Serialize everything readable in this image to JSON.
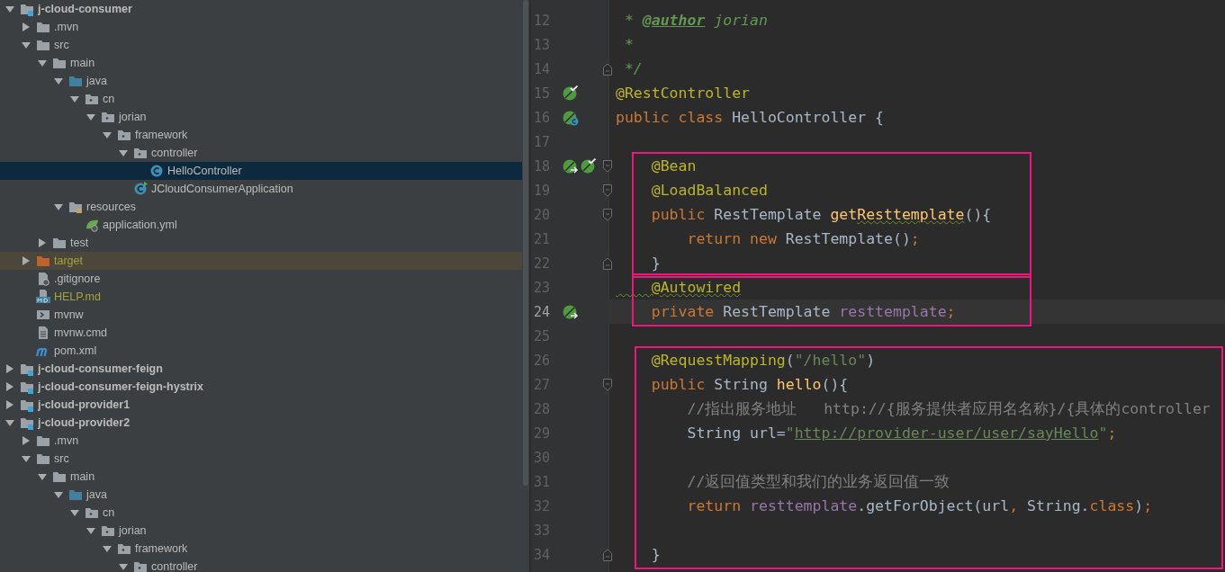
{
  "project_tree": {
    "items": [
      {
        "label": "j-cloud-consumer",
        "kind": "module",
        "expanded": true,
        "selected": false,
        "ignored": false,
        "children": [
          {
            "label": ".mvn",
            "kind": "folder",
            "expanded": false,
            "selected": false,
            "ignored": false
          },
          {
            "label": "src",
            "kind": "folder",
            "expanded": true,
            "selected": false,
            "ignored": false,
            "children": [
              {
                "label": "main",
                "kind": "folder",
                "expanded": true,
                "selected": false,
                "ignored": false,
                "children": [
                  {
                    "label": "java",
                    "kind": "source",
                    "expanded": true,
                    "selected": false,
                    "ignored": false,
                    "children": [
                      {
                        "label": "cn",
                        "kind": "package",
                        "expanded": true,
                        "selected": false,
                        "ignored": false,
                        "children": [
                          {
                            "label": "jorian",
                            "kind": "package",
                            "expanded": true,
                            "selected": false,
                            "ignored": false,
                            "children": [
                              {
                                "label": "framework",
                                "kind": "package",
                                "expanded": true,
                                "selected": false,
                                "ignored": false,
                                "children": [
                                  {
                                    "label": "controller",
                                    "kind": "package",
                                    "expanded": true,
                                    "selected": false,
                                    "ignored": false,
                                    "children": [
                                      {
                                        "label": "HelloController",
                                        "kind": "class",
                                        "selected": true,
                                        "ignored": false
                                      }
                                    ]
                                  },
                                  {
                                    "label": "JCloudConsumerApplication",
                                    "kind": "app",
                                    "selected": false,
                                    "ignored": false
                                  }
                                ]
                              }
                            ]
                          }
                        ]
                      }
                    ]
                  },
                  {
                    "label": "resources",
                    "kind": "resources",
                    "expanded": true,
                    "selected": false,
                    "ignored": false,
                    "children": [
                      {
                        "label": "application.yml",
                        "kind": "yml",
                        "selected": false,
                        "ignored": false
                      }
                    ]
                  }
                ]
              },
              {
                "label": "test",
                "kind": "folder",
                "expanded": false,
                "selected": false,
                "ignored": false
              }
            ]
          },
          {
            "label": "target",
            "kind": "excluded",
            "expanded": false,
            "selected": false,
            "ignored": true
          },
          {
            "label": ".gitignore",
            "kind": "ignorefile",
            "selected": false,
            "ignored": false
          },
          {
            "label": "HELP.md",
            "kind": "md",
            "selected": false,
            "ignored": true
          },
          {
            "label": "mvnw",
            "kind": "exec",
            "selected": false,
            "ignored": false
          },
          {
            "label": "mvnw.cmd",
            "kind": "text",
            "selected": false,
            "ignored": false
          },
          {
            "label": "pom.xml",
            "kind": "maven",
            "selected": false,
            "ignored": false
          }
        ]
      },
      {
        "label": "j-cloud-consumer-feign",
        "kind": "module",
        "expanded": false,
        "selected": false,
        "ignored": false
      },
      {
        "label": "j-cloud-consumer-feign-hystrix",
        "kind": "module",
        "expanded": false,
        "selected": false,
        "ignored": false
      },
      {
        "label": "j-cloud-provider1",
        "kind": "module",
        "expanded": false,
        "selected": false,
        "ignored": false
      },
      {
        "label": "j-cloud-provider2",
        "kind": "module",
        "expanded": true,
        "selected": false,
        "ignored": false,
        "children": [
          {
            "label": ".mvn",
            "kind": "folder",
            "expanded": false,
            "selected": false,
            "ignored": false
          },
          {
            "label": "src",
            "kind": "folder",
            "expanded": true,
            "selected": false,
            "ignored": false,
            "children": [
              {
                "label": "main",
                "kind": "folder",
                "expanded": true,
                "selected": false,
                "ignored": false,
                "children": [
                  {
                    "label": "java",
                    "kind": "source",
                    "expanded": true,
                    "selected": false,
                    "ignored": false,
                    "children": [
                      {
                        "label": "cn",
                        "kind": "package",
                        "expanded": true,
                        "selected": false,
                        "ignored": false,
                        "children": [
                          {
                            "label": "jorian",
                            "kind": "package",
                            "expanded": true,
                            "selected": false,
                            "ignored": false,
                            "children": [
                              {
                                "label": "framework",
                                "kind": "package",
                                "expanded": true,
                                "selected": false,
                                "ignored": false,
                                "children": [
                                  {
                                    "label": "controller",
                                    "kind": "package",
                                    "expanded": true,
                                    "selected": false,
                                    "ignored": false
                                  }
                                ]
                              }
                            ]
                          }
                        ]
                      }
                    ]
                  }
                ]
              }
            ]
          }
        ]
      }
    ]
  },
  "editor": {
    "sections": [
      {
        "boxed": false,
        "lines": [
          {
            "number": "12",
            "current": false,
            "tokens": [
              {
                "kind": "doc",
                "text": " * "
              },
              {
                "kind": "doctag",
                "text": "@author"
              },
              {
                "kind": "doc",
                "text": " jorian"
              }
            ]
          },
          {
            "number": "13",
            "current": false,
            "tokens": [
              {
                "kind": "doc",
                "text": " *"
              }
            ]
          },
          {
            "number": "14",
            "current": false,
            "fold": {
              "kind": "end"
            },
            "tokens": [
              {
                "kind": "doc",
                "text": " */"
              }
            ]
          },
          {
            "number": "15",
            "current": false,
            "gutter": [
              {
                "kind": "check"
              }
            ],
            "tokens": [
              {
                "kind": "ann",
                "text": "@RestController"
              }
            ]
          },
          {
            "number": "16",
            "current": false,
            "gutter": [
              {
                "kind": "class"
              }
            ],
            "tokens": [
              {
                "kind": "kw",
                "text": "public class "
              },
              {
                "kind": "plain",
                "text": "HelloController {"
              }
            ]
          },
          {
            "number": "17",
            "current": false
          }
        ]
      },
      {
        "boxed": true,
        "lines": [
          {
            "number": "18",
            "current": false,
            "fold": {
              "kind": "start"
            },
            "gutter": [
              {
                "kind": "arrow"
              },
              {
                "kind": "check"
              }
            ],
            "tokens": [
              {
                "kind": "ann",
                "text": "    @Bean"
              }
            ]
          },
          {
            "number": "19",
            "current": false,
            "fold": {
              "kind": "start"
            },
            "tokens": [
              {
                "kind": "ann",
                "text": "    @LoadBalanced"
              }
            ]
          },
          {
            "number": "20",
            "current": false,
            "fold": {
              "kind": "start"
            },
            "tokens": [
              {
                "kind": "kw",
                "text": "    public "
              },
              {
                "kind": "plain",
                "text": "RestTemplate "
              },
              {
                "kind": "method",
                "text": "get"
              },
              {
                "kind": "method-typo",
                "text": "Resttemplate"
              },
              {
                "kind": "plain",
                "text": "(){"
              }
            ]
          },
          {
            "number": "21",
            "current": false,
            "tokens": [
              {
                "kind": "kw",
                "text": "        return new "
              },
              {
                "kind": "plain",
                "text": "RestTemplate()"
              },
              {
                "kind": "kw",
                "text": ";"
              }
            ]
          },
          {
            "number": "22",
            "current": false,
            "fold": {
              "kind": "end"
            },
            "tokens": [
              {
                "kind": "plain",
                "text": "    }"
              }
            ]
          }
        ]
      },
      {
        "boxed": true,
        "lines": [
          {
            "number": "23",
            "current": false,
            "tokens": [
              {
                "kind": "ann-typo",
                "text": "    @Autowired"
              }
            ]
          },
          {
            "number": "24",
            "current": true,
            "gutter": [
              {
                "kind": "arrow"
              }
            ],
            "tokens": [
              {
                "kind": "kw",
                "text": "    private "
              },
              {
                "kind": "plain",
                "text": "RestTemplate "
              },
              {
                "kind": "field",
                "text": "resttemplate"
              },
              {
                "kind": "kw",
                "text": ";"
              }
            ]
          }
        ]
      },
      {
        "boxed": false,
        "lines": [
          {
            "number": "25",
            "current": false
          }
        ]
      },
      {
        "boxed": true,
        "lines": [
          {
            "number": "26",
            "current": false,
            "tokens": [
              {
                "kind": "ann",
                "text": "    @RequestMapping"
              },
              {
                "kind": "plain",
                "text": "("
              },
              {
                "kind": "str",
                "text": "\"/hello\""
              },
              {
                "kind": "plain",
                "text": ")"
              }
            ]
          },
          {
            "number": "27",
            "current": false,
            "fold": {
              "kind": "start"
            },
            "tokens": [
              {
                "kind": "kw",
                "text": "    public "
              },
              {
                "kind": "plain",
                "text": "String "
              },
              {
                "kind": "method",
                "text": "hello"
              },
              {
                "kind": "plain",
                "text": "(){"
              }
            ]
          },
          {
            "number": "28",
            "current": false,
            "tokens": [
              {
                "kind": "comment",
                "text": "        //指出服务地址   http://{服务提供者应用名名称}/{具体的controller"
              }
            ]
          },
          {
            "number": "29",
            "current": false,
            "tokens": [
              {
                "kind": "plain",
                "text": "        String url="
              },
              {
                "kind": "str",
                "text": "\""
              },
              {
                "kind": "link",
                "text": "http://provider-user/user/sayHello"
              },
              {
                "kind": "str",
                "text": "\""
              },
              {
                "kind": "kw",
                "text": ";"
              }
            ]
          },
          {
            "number": "30",
            "current": false
          },
          {
            "number": "31",
            "current": false,
            "tokens": [
              {
                "kind": "comment",
                "text": "        //返回值类型和我们的业务返回值一致"
              }
            ]
          },
          {
            "number": "32",
            "current": false,
            "tokens": [
              {
                "kind": "kw",
                "text": "        return "
              },
              {
                "kind": "field",
                "text": "resttemplate"
              },
              {
                "kind": "plain",
                "text": ".getForObject(url"
              },
              {
                "kind": "kw",
                "text": ", "
              },
              {
                "kind": "plain",
                "text": "String."
              },
              {
                "kind": "kw",
                "text": "class"
              },
              {
                "kind": "plain",
                "text": ")"
              },
              {
                "kind": "kw",
                "text": ";"
              }
            ]
          },
          {
            "number": "33",
            "current": false
          },
          {
            "number": "34",
            "current": false,
            "fold": {
              "kind": "end"
            },
            "tokens": [
              {
                "kind": "plain",
                "text": "    }"
              }
            ]
          }
        ]
      }
    ]
  }
}
